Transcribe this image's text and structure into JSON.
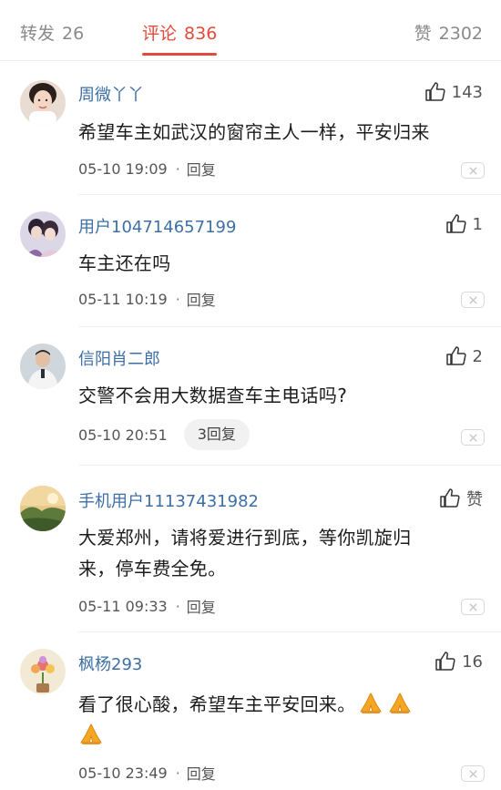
{
  "tabs": {
    "repost": {
      "label": "转发",
      "count": "26"
    },
    "comment": {
      "label": "评论",
      "count": "836"
    },
    "like": {
      "label": "赞",
      "count": "2302"
    }
  },
  "colors": {
    "accent": "#e24b3b",
    "username": "#3d6fa6"
  },
  "comments": [
    {
      "username": "周微丫丫",
      "likes": "143",
      "text": "希望车主如武汉的窗帘主人一样，平安归来",
      "time": "05-10 19:09",
      "reply": "回复"
    },
    {
      "username": "用户104714657199",
      "likes": "1",
      "text": "车主还在吗",
      "time": "05-11 10:19",
      "reply": "回复"
    },
    {
      "username": "信阳肖二郎",
      "likes": "2",
      "text": "交警不会用大数据查车主电话吗?",
      "time": "05-10 20:51",
      "reply": "3回复"
    },
    {
      "username": "手机用户11137431982",
      "likes": "赞",
      "text_line1": "大爱郑州，请将爱进行到底，等你凯旋归",
      "text_line2": "来，停车费全免。",
      "time": "05-11 09:33",
      "reply": "回复"
    },
    {
      "username": "枫杨293",
      "likes": "16",
      "text": "看了很心酸，希望车主平安回来。",
      "emoji": "praying-hands",
      "time": "05-10 23:49",
      "reply": "回复"
    }
  ],
  "meta_separator": "·"
}
